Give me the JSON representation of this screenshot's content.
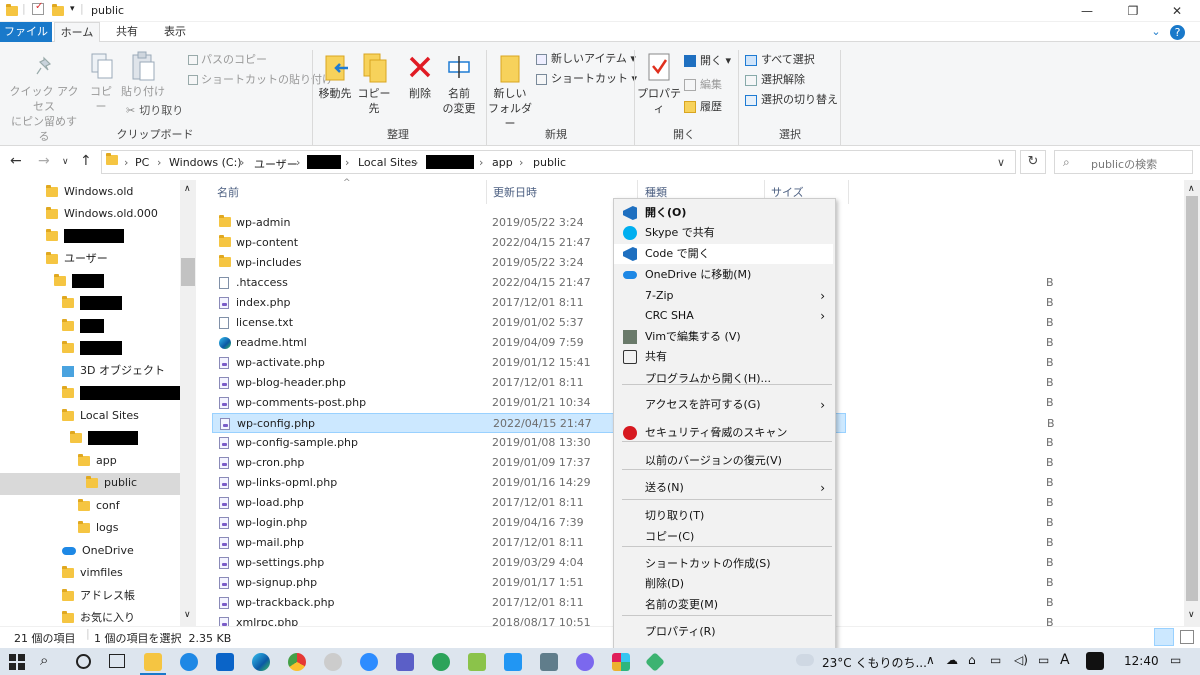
{
  "window": {
    "title": "public",
    "minimize": "—",
    "maximize": "❐",
    "close": "✕",
    "expand": "⌄",
    "help": "?"
  },
  "tabs": [
    "ファイル",
    "ホーム",
    "共有",
    "表示"
  ],
  "ribbon": {
    "clipboard": {
      "pin_label_1": "クイック アクセス",
      "pin_label_2": "にピン留めする",
      "copy": "コピー",
      "paste": "貼り付け",
      "copy_path": "パスのコピー",
      "paste_shortcut": "ショートカットの貼り付け",
      "cut": "切り取り",
      "group": "クリップボード"
    },
    "organize": {
      "move_to": "移動先",
      "copy_to": "コピー先",
      "delete": "削除",
      "rename_1": "名前",
      "rename_2": "の変更",
      "group": "整理"
    },
    "new": {
      "new_folder_1": "新しい",
      "new_folder_2": "フォルダー",
      "new_item": "新しいアイテム",
      "shortcut": "ショートカット",
      "group": "新規"
    },
    "open": {
      "properties": "プロパティ",
      "open": "開く",
      "edit": "編集",
      "history": "履歴",
      "group": "開く"
    },
    "select": {
      "select_all": "すべて選択",
      "select_none": "選択解除",
      "invert": "選択の切り替え",
      "group": "選択"
    }
  },
  "address": {
    "crumbs": [
      "PC",
      "Windows (C:)",
      "ユーザー",
      "Local Sites",
      "app",
      "public"
    ],
    "search_placeholder": "publicの検索"
  },
  "nav": [
    {
      "label": "Windows.old"
    },
    {
      "label": "Windows.old.000"
    },
    {
      "label": ""
    },
    {
      "label": "ユーザー"
    },
    {
      "label": ""
    },
    {
      "label": ""
    },
    {
      "label": ""
    },
    {
      "label": ""
    },
    {
      "label": "3D オブジェクト"
    },
    {
      "label": ""
    },
    {
      "label": "Local Sites"
    },
    {
      "label": ""
    },
    {
      "label": "app"
    },
    {
      "label": "public"
    },
    {
      "label": "conf"
    },
    {
      "label": "logs"
    },
    {
      "label": "OneDrive"
    },
    {
      "label": "vimfiles"
    },
    {
      "label": "アドレス帳"
    },
    {
      "label": "お気に入り"
    }
  ],
  "columns": {
    "name": "名前",
    "date": "更新日時",
    "type": "種類",
    "size": "サイズ"
  },
  "files": [
    {
      "name": "wp-admin",
      "date": "2019/05/22 3:24",
      "kind": "folder"
    },
    {
      "name": "wp-content",
      "date": "2022/04/15 21:47",
      "kind": "folder"
    },
    {
      "name": "wp-includes",
      "date": "2019/05/22 3:24",
      "kind": "folder"
    },
    {
      "name": ".htaccess",
      "date": "2022/04/15 21:47",
      "kind": "file"
    },
    {
      "name": "index.php",
      "date": "2017/12/01 8:11",
      "kind": "php"
    },
    {
      "name": "license.txt",
      "date": "2019/01/02 5:37",
      "kind": "file"
    },
    {
      "name": "readme.html",
      "date": "2019/04/09 7:59",
      "kind": "edge"
    },
    {
      "name": "wp-activate.php",
      "date": "2019/01/12 15:41",
      "kind": "php"
    },
    {
      "name": "wp-blog-header.php",
      "date": "2017/12/01 8:11",
      "kind": "php"
    },
    {
      "name": "wp-comments-post.php",
      "date": "2019/01/21 10:34",
      "kind": "php"
    },
    {
      "name": "wp-config.php",
      "date": "2022/04/15 21:47",
      "kind": "php"
    },
    {
      "name": "wp-config-sample.php",
      "date": "2019/01/08 13:30",
      "kind": "php"
    },
    {
      "name": "wp-cron.php",
      "date": "2019/01/09 17:37",
      "kind": "php"
    },
    {
      "name": "wp-links-opml.php",
      "date": "2019/01/16 14:29",
      "kind": "php"
    },
    {
      "name": "wp-load.php",
      "date": "2017/12/01 8:11",
      "kind": "php"
    },
    {
      "name": "wp-login.php",
      "date": "2019/04/16 7:39",
      "kind": "php"
    },
    {
      "name": "wp-mail.php",
      "date": "2017/12/01 8:11",
      "kind": "php"
    },
    {
      "name": "wp-settings.php",
      "date": "2019/03/29 4:04",
      "kind": "php"
    },
    {
      "name": "wp-signup.php",
      "date": "2019/01/17 1:51",
      "kind": "php"
    },
    {
      "name": "wp-trackback.php",
      "date": "2017/12/01 8:11",
      "kind": "php"
    },
    {
      "name": "xmlrpc.php",
      "date": "2018/08/17 10:51",
      "kind": "php"
    }
  ],
  "size_fragment": "B",
  "status": {
    "count": "21 個の項目",
    "selection": "1 個の項目を選択  2.35 KB"
  },
  "context_menu": [
    {
      "label": "開く(O)",
      "icon": "vscode-icon",
      "bold": true
    },
    {
      "label": "Skype で共有",
      "icon": "skype-icon"
    },
    {
      "label": "Code で開く",
      "icon": "vscode-icon",
      "highlight": true
    },
    {
      "label": "OneDrive に移動(M)",
      "icon": "onedrive-icon"
    },
    {
      "label": "7-Zip",
      "submenu": true
    },
    {
      "label": "CRC SHA",
      "submenu": true
    },
    {
      "label": "Vimで編集する (V)",
      "icon": "vim-icon"
    },
    {
      "label": "共有",
      "icon": "share-icon"
    },
    {
      "label": "プログラムから開く(H)..."
    },
    {
      "label": "アクセスを許可する(G)",
      "submenu": true
    },
    {
      "label": "セキュリティ脅威のスキャン",
      "icon": "trendmicro-icon"
    },
    {
      "label": "以前のバージョンの復元(V)"
    },
    {
      "label": "送る(N)",
      "submenu": true
    },
    {
      "label": "切り取り(T)"
    },
    {
      "label": "コピー(C)"
    },
    {
      "label": "ショートカットの作成(S)"
    },
    {
      "label": "削除(D)"
    },
    {
      "label": "名前の変更(M)"
    },
    {
      "label": "プロパティ(R)"
    }
  ],
  "taskbar": {
    "weather": "23°C  くもりのち...",
    "time": "12:40",
    "ime": "A"
  }
}
